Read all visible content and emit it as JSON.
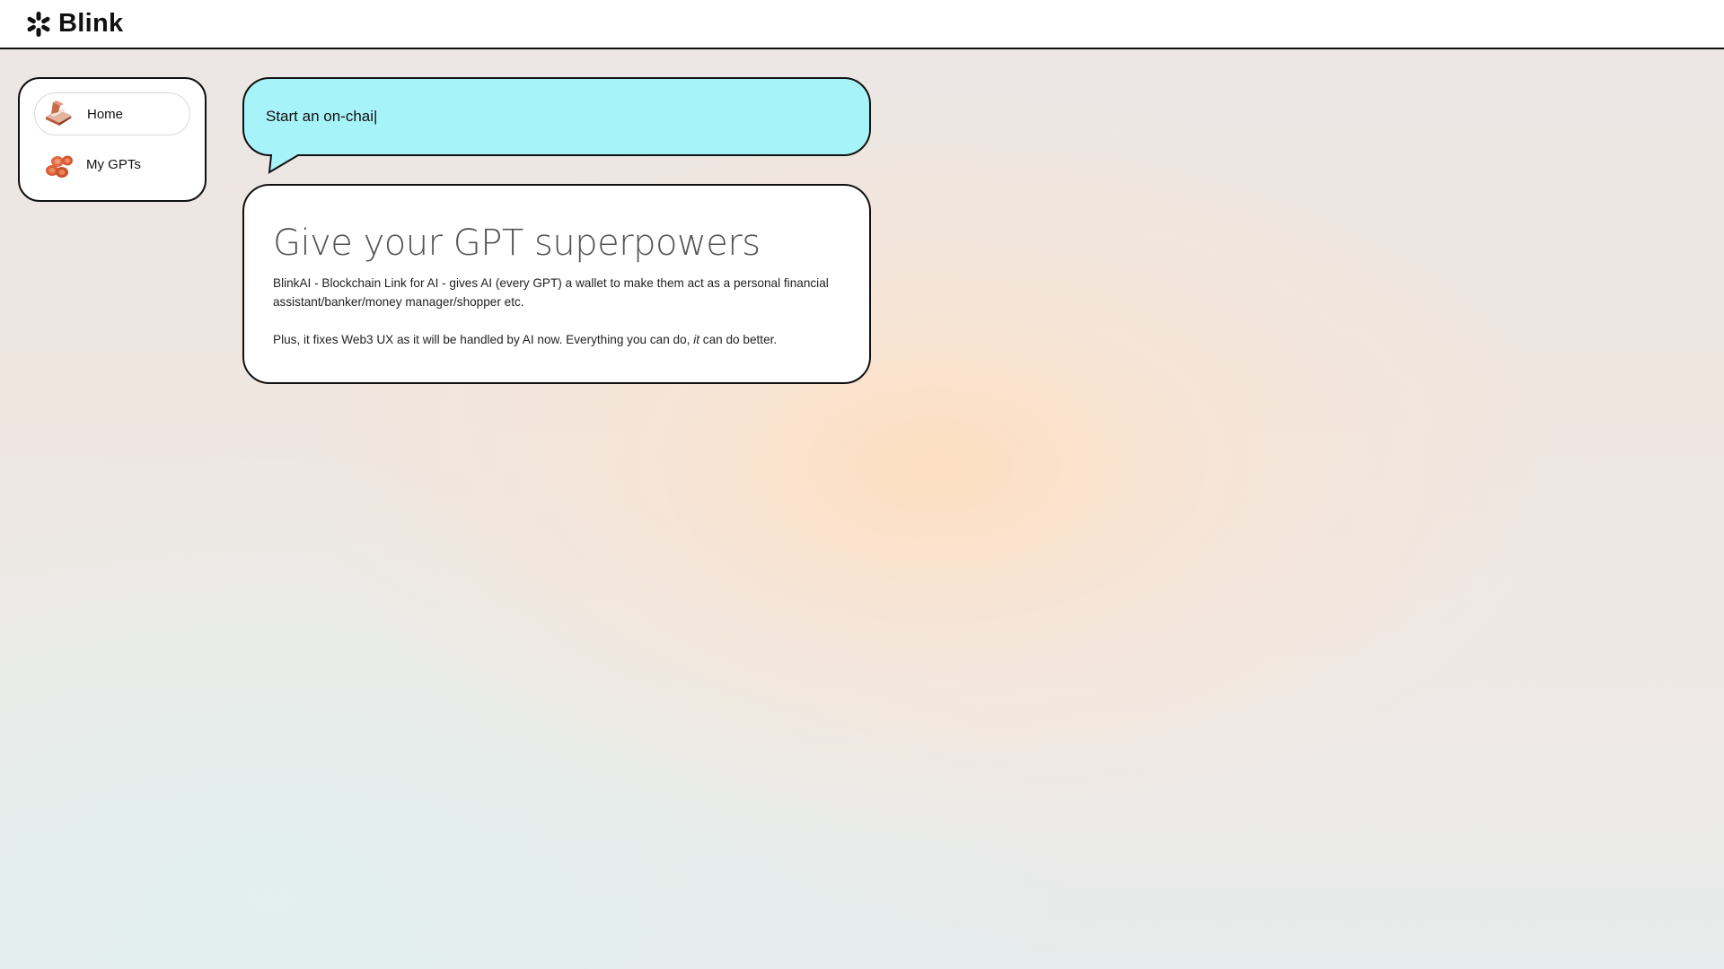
{
  "app": {
    "logo_text": "Blink"
  },
  "sidebar": {
    "items": [
      {
        "label": "Home",
        "icon": "wallet-icon",
        "active": true
      },
      {
        "label": "My GPTs",
        "icon": "coins-icon",
        "active": false
      }
    ]
  },
  "prompt": {
    "value": "Start an on-chai|"
  },
  "card": {
    "title": "Give your GPT superpowers",
    "paragraph1": "BlinkAI - Blockchain Link for AI - gives AI (every GPT) a wallet to make them act as a personal financial assistant/banker/money manager/shopper etc.",
    "paragraph2_before": "Plus, it fixes Web3 UX as it will be handled by AI now. Everything you can do, ",
    "paragraph2_em": "it",
    "paragraph2_after": " can do better."
  },
  "colors": {
    "prompt_bubble": "#a7f3fa",
    "border": "#111111",
    "accent_orange": "#d9603b"
  }
}
